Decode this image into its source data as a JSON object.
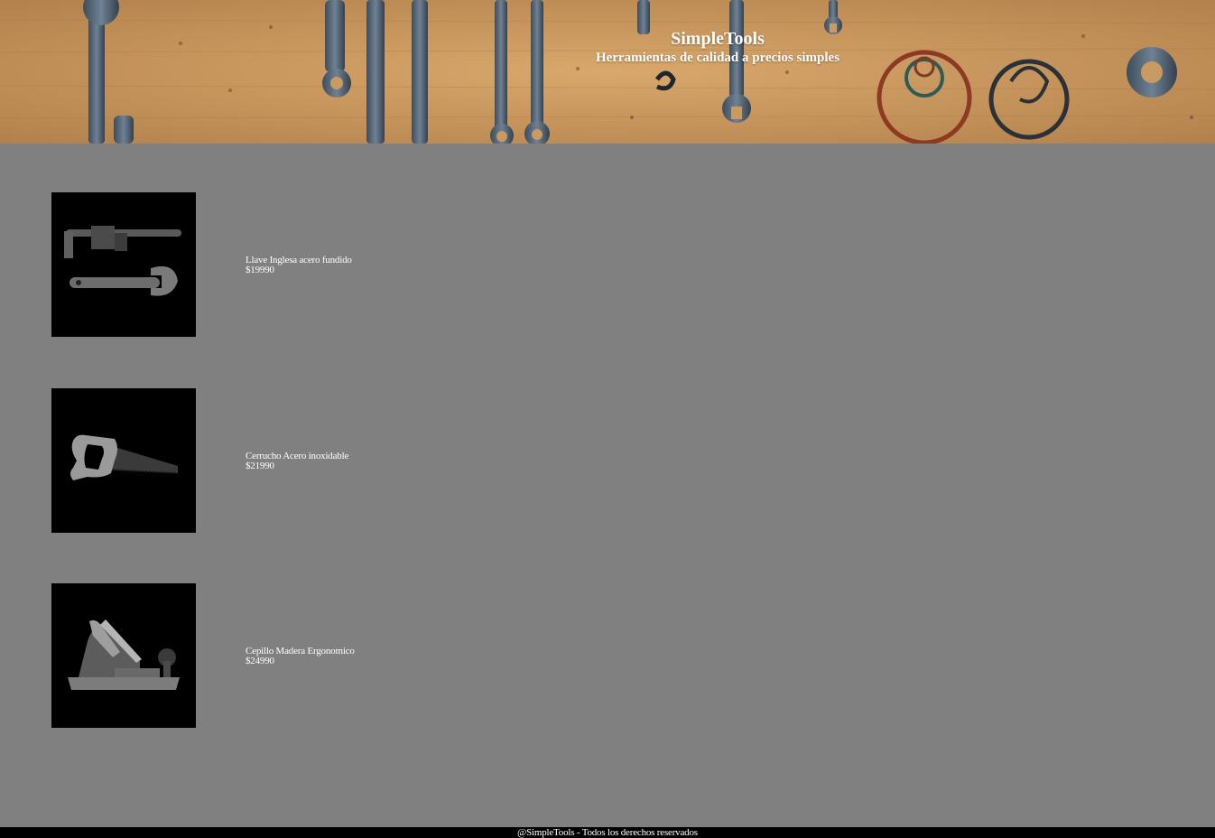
{
  "header": {
    "title": "SimpleTools",
    "subtitle": "Herramientas de calidad a precios simples",
    "background": "tools-on-wooden-wall"
  },
  "products": [
    {
      "name": "Llave Inglesa acero fundido",
      "price": "$19990",
      "image": "wrench-image"
    },
    {
      "name": "Cerrucho Acero inoxidable",
      "price": "$21990",
      "image": "hand-saw-image"
    },
    {
      "name": "Cepillo Madera Ergonomico",
      "price": "$24990",
      "image": "wood-plane-image"
    }
  ],
  "footer": {
    "text": "@SimpleTools - Todos los derechos reservados"
  },
  "colors": {
    "page_background": "#808080",
    "footer_background": "#000000",
    "text": "#ffffff"
  }
}
